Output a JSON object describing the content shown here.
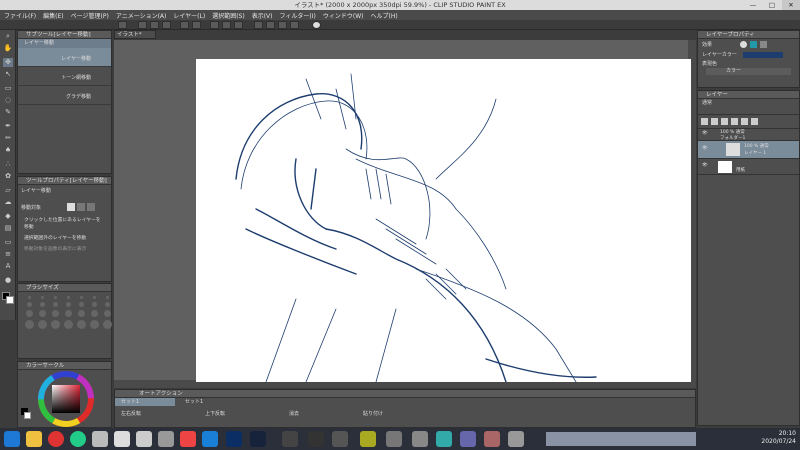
{
  "window": {
    "title": "イラスト* (2000 x 2000px 350dpi 59.9%) - CLIP STUDIO PAINT EX",
    "minimize": "—",
    "maximize": "□",
    "close": "✕"
  },
  "menu": [
    "ファイル(F)",
    "編集(E)",
    "ページ管理(P)",
    "アニメーション(A)",
    "レイヤー(L)",
    "選択範囲(S)",
    "表示(V)",
    "フィルター(I)",
    "ウィンドウ(W)",
    "ヘルプ(H)"
  ],
  "subtool_panel": {
    "title": "サブツール[レイヤー移動]",
    "header_item": "レイヤー移動",
    "items": [
      "レイヤー移動",
      "トーン網移動",
      "グラデ移動"
    ]
  },
  "tool_property": {
    "title": "ツールプロパティ[レイヤー移動]",
    "tool_name": "レイヤー移動",
    "target_label": "移動対象",
    "options": [
      "クリックした位置にあるレイヤーを移動",
      "選択範囲外のレイヤーを移動",
      "移動対象を画像の表示に表示"
    ]
  },
  "brush_size_panel": {
    "title": "ブラシサイズ"
  },
  "color_wheel_panel": {
    "title": "カラーサークル"
  },
  "document_tab": "イラスト*",
  "layer_property": {
    "title": "レイヤープロパティ",
    "effect_label": "効果",
    "layer_color_label": "レイヤーカラー",
    "expression_label": "表現色",
    "expression_value": "カラー"
  },
  "layer_panel": {
    "title": "レイヤー",
    "blend_mode": "通常",
    "folder_name": "100 % 通常",
    "folder_label": "フォルダー1",
    "layer_sel_pct": "100 % 通常",
    "layer_sel_name": "レイヤー 1",
    "paper_name": "用紙"
  },
  "auto_action": {
    "title": "オートアクション",
    "set_label": "セット1",
    "set_label2": "セット1",
    "actions": [
      "左右反転",
      "上下反転",
      "消去",
      "貼り付け"
    ]
  },
  "clock": {
    "time": "20:10",
    "date": "2020/07/24"
  },
  "colors": {
    "stroke": "#1d3d6e",
    "selected_row": "#7a8b9a",
    "taskbar": "#2b2f3a"
  }
}
